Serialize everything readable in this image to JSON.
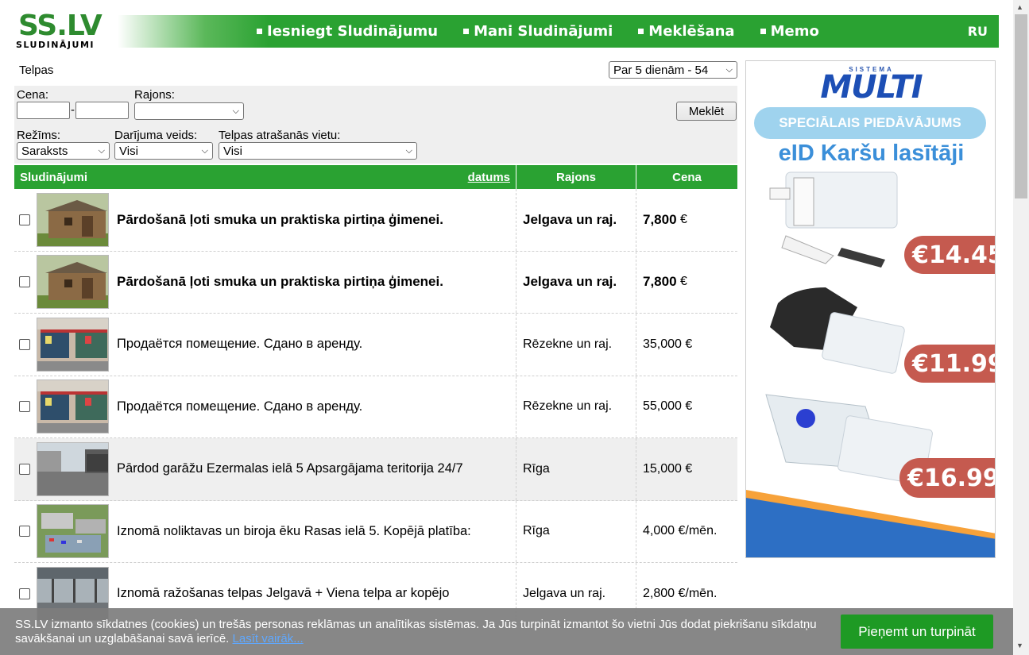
{
  "header": {
    "logo_big": "SS.LV",
    "logo_small": "SLUDINĀJUMI",
    "menu": [
      "Iesniegt Sludinājumu",
      "Mani Sludinājumi",
      "Meklēšana",
      "Memo"
    ],
    "lang": "RU",
    "colors": {
      "green": "#2aa232",
      "logo_green": "#2e8b2f"
    }
  },
  "breadcrumb": "Telpas",
  "period_select": "Par 5 dienām - 54",
  "filters": {
    "price_label": "Cena:",
    "price_dash": "-",
    "district_label": "Rajons:",
    "search_button": "Meklēt",
    "mode_label": "Režīms:",
    "mode_value": "Saraksts",
    "deal_label": "Darījuma veids:",
    "deal_value": "Visi",
    "location_label": "Telpas atrašanās vietu:",
    "location_value": "Visi"
  },
  "table": {
    "headers": {
      "ads": "Sludinājumi",
      "date_sort": "datums",
      "district": "Rajons",
      "price": "Cena"
    },
    "rows": [
      {
        "title": "Pārdošanā ļoti smuka un praktiska pirtiņa ģimenei.",
        "district": "Jelgava un raj.",
        "price": "7,800",
        "currency": " €",
        "bold": true,
        "thumb": "sauna"
      },
      {
        "title": "Pārdošanā ļoti smuka un praktiska pirtiņa ģimenei.",
        "district": "Jelgava un raj.",
        "price": "7,800",
        "currency": " €",
        "bold": true,
        "thumb": "sauna"
      },
      {
        "title": "Продаётся помещение. Сдано в аренду.",
        "district": "Rēzekne un raj.",
        "price": "35,000",
        "currency": " €",
        "bold": false,
        "thumb": "shopfront"
      },
      {
        "title": "Продаётся помещение. Сдано в аренду.",
        "district": "Rēzekne un raj.",
        "price": "55,000",
        "currency": " €",
        "bold": false,
        "thumb": "shopfront"
      },
      {
        "title": "Pārdod garāžu Ezermalas ielā 5 Apsargājama teritorija 24/7",
        "district": "Rīga",
        "price": "15,000",
        "currency": " €",
        "bold": false,
        "thumb": "garage"
      },
      {
        "title": "Iznomā noliktavas un biroja ēku Rasas ielā 5. Kopējā platība:",
        "district": "Rīga",
        "price": "4,000",
        "currency": " €/mēn.",
        "bold": false,
        "thumb": "aerial"
      },
      {
        "title": "Iznomā ražošanas telpas Jelgavā + Viena telpa ar kopējo",
        "district": "Jelgava un raj.",
        "price": "2,800",
        "currency": " €/mēn.",
        "bold": false,
        "thumb": "hall"
      }
    ]
  },
  "ad": {
    "brand_small": "SISTEMA",
    "brand": "MULTI",
    "special": "SPECIĀLAIS PIEDĀVĀJUMS",
    "headline": "eID Karšu lasītāji",
    "prices": [
      "€14.45",
      "€11.99",
      "€16.99"
    ]
  },
  "cookie": {
    "text": "SS.LV izmanto sīkdatnes (cookies) un trešās personas reklāmas un analītikas sistēmas. Ja Jūs turpināt izmantot šo vietni Jūs dodat piekrišanu sīkdatņu savākšanai un uzglabāšanai savā ierīcē.",
    "link": "Lasīt vairāk...",
    "button": "Pieņemt un turpināt"
  }
}
